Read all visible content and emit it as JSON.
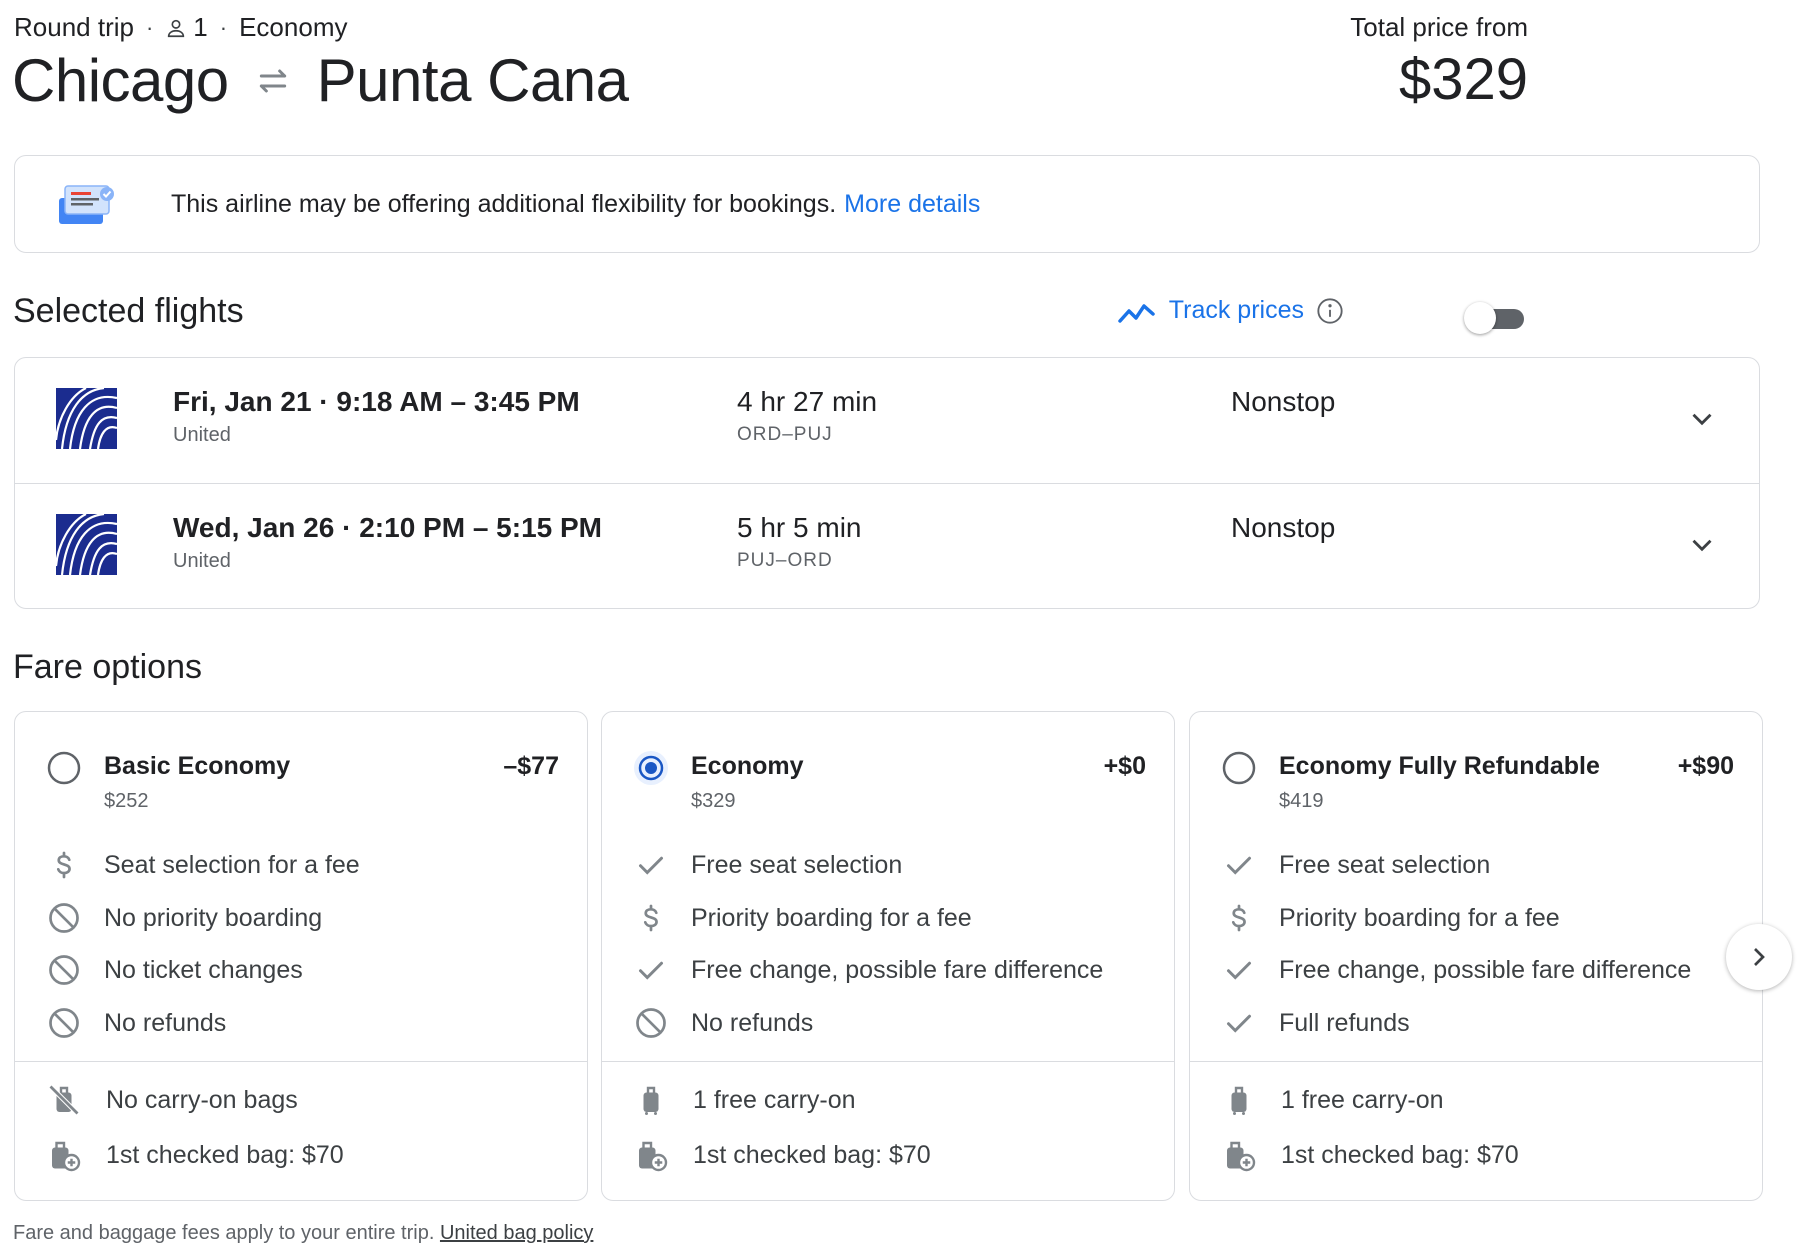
{
  "header": {
    "trip_type": "Round trip",
    "passengers": "1",
    "cabin": "Economy",
    "origin": "Chicago",
    "destination": "Punta Cana",
    "price_label": "Total price from",
    "price": "$329"
  },
  "banner": {
    "text": "This airline may be offering additional flexibility for bookings.",
    "link": "More details"
  },
  "selected_flights": {
    "title": "Selected flights",
    "track_label": "Track prices",
    "track_enabled": false,
    "flights": [
      {
        "date": "Fri, Jan 21",
        "times": "9:18 AM – 3:45 PM",
        "airline": "United",
        "duration": "4 hr 27 min",
        "route": "ORD–PUJ",
        "stops": "Nonstop"
      },
      {
        "date": "Wed, Jan 26",
        "times": "2:10 PM – 5:15 PM",
        "airline": "United",
        "duration": "5 hr 5 min",
        "route": "PUJ–ORD",
        "stops": "Nonstop"
      }
    ]
  },
  "fare_options": {
    "title": "Fare options",
    "fares": [
      {
        "name": "Basic Economy",
        "price": "$252",
        "diff": "–$77",
        "selected": false,
        "features": [
          {
            "icon": "dollar-icon",
            "text": "Seat selection for a fee"
          },
          {
            "icon": "not-allowed-icon",
            "text": "No priority boarding"
          },
          {
            "icon": "not-allowed-icon",
            "text": "No ticket changes"
          },
          {
            "icon": "not-allowed-icon",
            "text": "No refunds"
          }
        ],
        "bags": [
          {
            "icon": "no-carry-on-icon",
            "text": "No carry-on bags"
          },
          {
            "icon": "checked-bag-icon",
            "text": "1st checked bag: $70"
          }
        ]
      },
      {
        "name": "Economy",
        "price": "$329",
        "diff": "+$0",
        "selected": true,
        "features": [
          {
            "icon": "check-icon",
            "text": "Free seat selection"
          },
          {
            "icon": "dollar-icon",
            "text": "Priority boarding for a fee"
          },
          {
            "icon": "check-icon",
            "text": "Free change, possible fare difference"
          },
          {
            "icon": "not-allowed-icon",
            "text": "No refunds"
          }
        ],
        "bags": [
          {
            "icon": "carry-on-icon",
            "text": "1 free carry-on"
          },
          {
            "icon": "checked-bag-icon",
            "text": "1st checked bag: $70"
          }
        ]
      },
      {
        "name": "Economy Fully Refundable",
        "price": "$419",
        "diff": "+$90",
        "selected": false,
        "features": [
          {
            "icon": "check-icon",
            "text": "Free seat selection"
          },
          {
            "icon": "dollar-icon",
            "text": "Priority boarding for a fee"
          },
          {
            "icon": "check-icon",
            "text": "Free change, possible fare difference"
          },
          {
            "icon": "check-icon",
            "text": "Full refunds"
          }
        ],
        "bags": [
          {
            "icon": "carry-on-icon",
            "text": "1 free carry-on"
          },
          {
            "icon": "checked-bag-icon",
            "text": "1st checked bag: $70"
          }
        ]
      }
    ]
  },
  "footer": {
    "text": "Fare and baggage fees apply to your entire trip.",
    "link": "United bag policy"
  },
  "colors": {
    "link": "#1a73e8",
    "selected_radio": "#1a57c4",
    "united_blue": "#1b2c8f"
  }
}
